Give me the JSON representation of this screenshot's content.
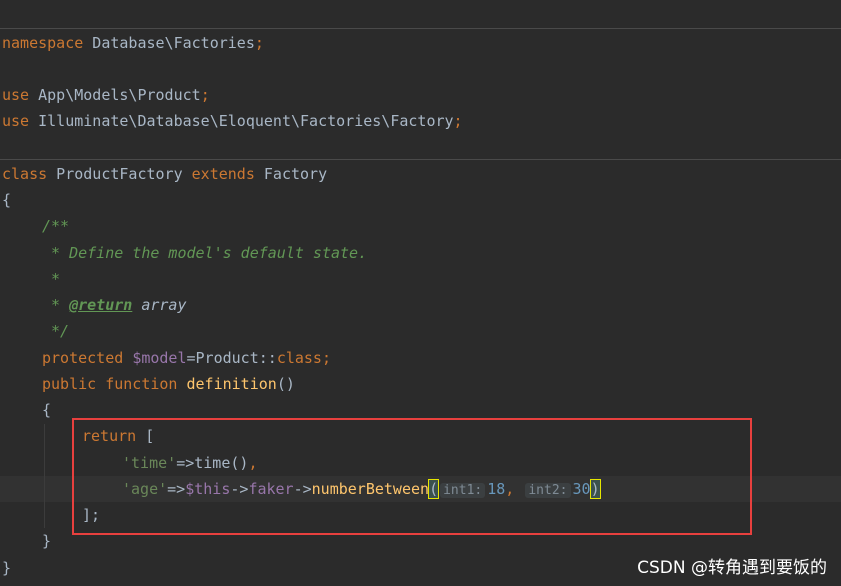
{
  "editor": {
    "namespace": {
      "kw": "namespace",
      "rest": " Database\\Factories",
      "semi": ";"
    },
    "use1": {
      "kw": "use",
      "rest": " App\\Models\\Product",
      "semi": ";"
    },
    "use2": {
      "kw": "use",
      "rest": " Illuminate\\Database\\Eloquent\\Factories\\Factory",
      "semi": ";"
    },
    "class_decl": {
      "kw_class": "class",
      "name": " ProductFactory ",
      "kw_extends": "extends",
      "parent": " Factory"
    },
    "open_brace": "{",
    "doc": {
      "open": "/**",
      "line1": " * Define the model's default state.",
      "star": " *",
      "return_prefix": " * ",
      "return_tag": "@return",
      "return_type": " array",
      "close": " */"
    },
    "model_prop": {
      "kw": "protected ",
      "var": "$model",
      "eq": "=Product::",
      "cls": "class",
      "semi": ";"
    },
    "method_decl": {
      "kw": "public function ",
      "fn": "definition",
      "paren": "()"
    },
    "method_open": "{",
    "return_kw": "return",
    "return_bracket": " [",
    "entry_time": {
      "key": "'time'",
      "arrow": "=>",
      "call": "time()",
      "comma": ","
    },
    "entry_age": {
      "key": "'age'",
      "arrow": "=>",
      "this": "$this",
      "op1": "->",
      "faker": "faker",
      "op2": "->",
      "fn": "numberBetween",
      "open": "(",
      "hint1": "int1:",
      "val1": "18",
      "comma": ", ",
      "hint2": "int2:",
      "val2": "30",
      "close": ")"
    },
    "close_bracket": "];",
    "method_close": "}",
    "class_close": "}"
  },
  "watermark": "CSDN @转角遇到要饭的",
  "colors": {
    "background": "#2b2b2b",
    "keyword": "#cc7832",
    "string": "#6a8759",
    "number": "#6897bb",
    "variable": "#9876aa",
    "function": "#ffc66d",
    "comment": "#629755",
    "highlight_box": "#e8403e"
  }
}
